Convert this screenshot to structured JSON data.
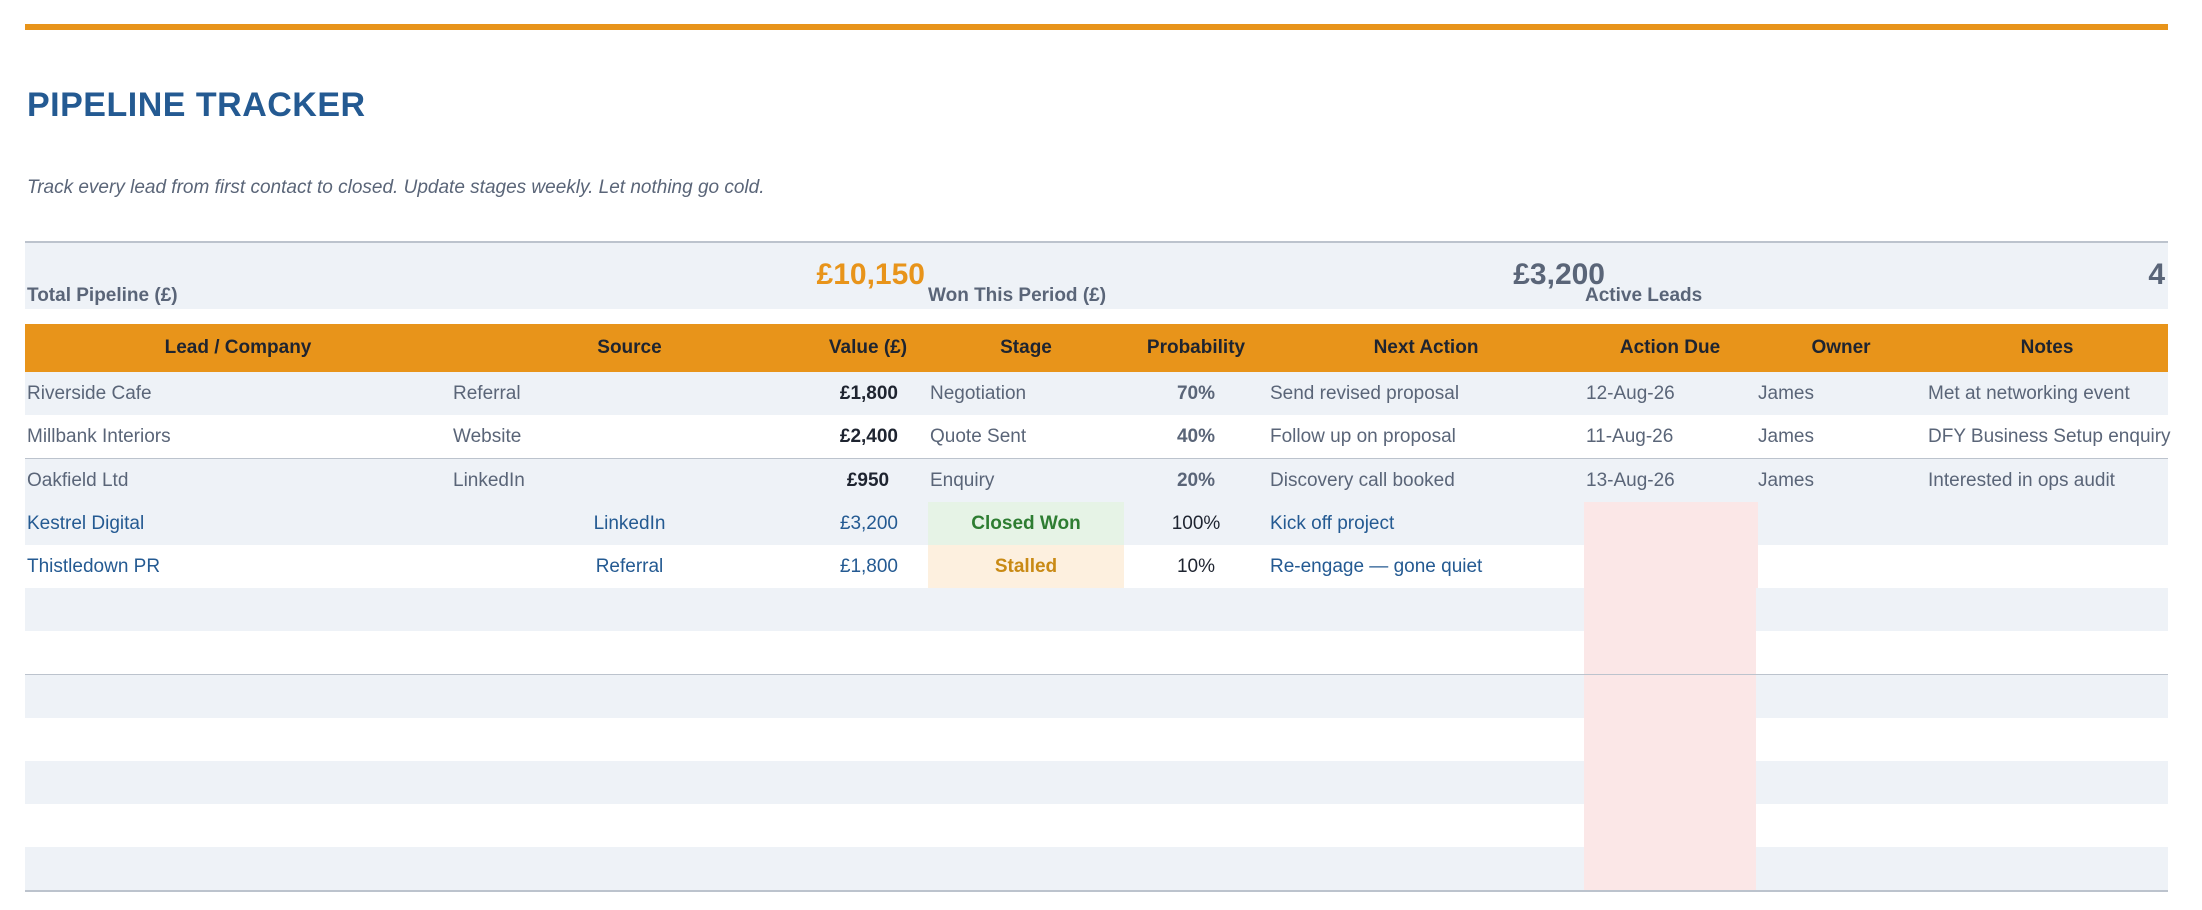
{
  "page": {
    "title": "PIPELINE TRACKER",
    "subtitle": "Track every lead from first contact to closed. Update stages weekly. Let nothing go cold."
  },
  "summary": {
    "total_pipeline_label": "Total Pipeline (£)",
    "total_pipeline_value": "£10,150",
    "won_label": "Won This Period (£)",
    "won_value": "£3,200",
    "active_label": "Active Leads",
    "active_value": "4"
  },
  "colors": {
    "accent": "#e8941a",
    "title_blue": "#245a92",
    "band": "#eef2f7",
    "won_bg": "#e6f3e6",
    "won_text": "#2e7d32",
    "stalled_bg": "#fdf0df",
    "stalled_text": "#c98a14",
    "overdue_bg": "#fbe7e7"
  },
  "table": {
    "columns": [
      "Lead / Company",
      "Source",
      "Value (£)",
      "Stage",
      "Probability",
      "Next Action",
      "Action Due",
      "Owner",
      "Notes"
    ],
    "rows": [
      {
        "lead": "Riverside Cafe",
        "source": "Referral",
        "value": "£1,800",
        "stage": "Negotiation",
        "probability": "70%",
        "next_action": "Send revised proposal",
        "due": "12-Aug-26",
        "owner": "James",
        "notes": "Met at networking event"
      },
      {
        "lead": "Millbank Interiors",
        "source": "Website",
        "value": "£2,400",
        "stage": "Quote Sent",
        "probability": "40%",
        "next_action": "Follow up on proposal",
        "due": "11-Aug-26",
        "owner": "James",
        "notes": "DFY Business Setup enquiry"
      },
      {
        "lead": "Oakfield Ltd",
        "source": "LinkedIn",
        "value": "£950",
        "stage": "Enquiry",
        "probability": "20%",
        "next_action": "Discovery call booked",
        "due": "13-Aug-26",
        "owner": "James",
        "notes": "Interested in ops audit"
      },
      {
        "lead": "Kestrel Digital",
        "source": "LinkedIn",
        "value": "£3,200",
        "stage": "Closed Won",
        "probability": "100%",
        "next_action": "Kick off project",
        "due": "",
        "owner": "",
        "notes": ""
      },
      {
        "lead": "Thistledown PR",
        "source": "Referral",
        "value": "£1,800",
        "stage": "Stalled",
        "probability": "10%",
        "next_action": "Re-engage — gone quiet",
        "due": "",
        "owner": "",
        "notes": ""
      }
    ]
  }
}
